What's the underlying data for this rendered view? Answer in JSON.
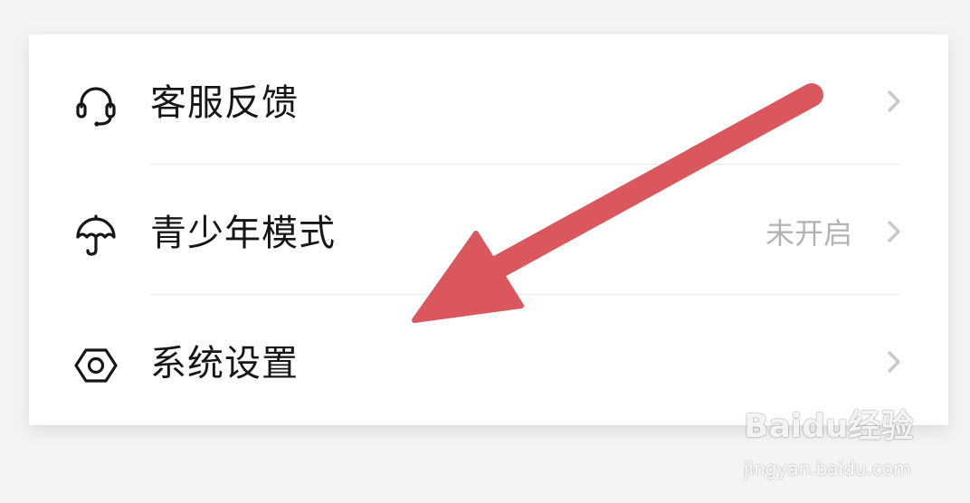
{
  "menu": {
    "items": [
      {
        "label": "客服反馈",
        "icon": "headset-icon",
        "status": ""
      },
      {
        "label": "青少年模式",
        "icon": "umbrella-icon",
        "status": "未开启"
      },
      {
        "label": "系统设置",
        "icon": "hexagon-nut-icon",
        "status": ""
      }
    ]
  },
  "annotation": {
    "arrow_color": "#d9575d",
    "points_to": "系统设置"
  },
  "watermark": {
    "brand": "Baidu经验",
    "url": "jingyan.baidu.com"
  }
}
